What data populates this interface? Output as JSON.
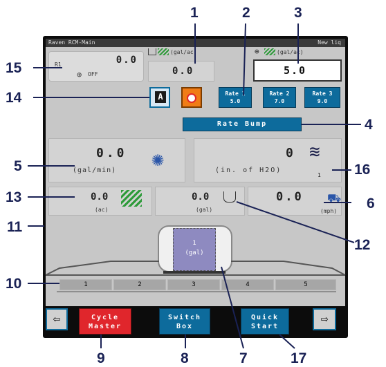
{
  "callouts": [
    "1",
    "2",
    "3",
    "4",
    "5",
    "6",
    "7",
    "8",
    "9",
    "10",
    "11",
    "12",
    "13",
    "14",
    "15",
    "16",
    "17"
  ],
  "titlebar": {
    "left": "Raven RCM-Main",
    "right": "New liq"
  },
  "master": {
    "row": "R1",
    "value": "0.0",
    "state": "OFF"
  },
  "actual": {
    "units": "(gal/ac)",
    "value": "0.0"
  },
  "target": {
    "units": "(gal/ac)",
    "value": "5.0"
  },
  "rates": [
    {
      "label": "Rate 1",
      "value": "5.0"
    },
    {
      "label": "Rate 2",
      "value": "7.0"
    },
    {
      "label": "Rate 3",
      "value": "9.0"
    }
  ],
  "rate_bump": "Rate Bump",
  "flow": {
    "value": "0.0",
    "units": "(gal/min)"
  },
  "pressure": {
    "value": "0",
    "units": "(in. of H2O)",
    "sensor": "1"
  },
  "area": {
    "value": "0.0",
    "units": "(ac)"
  },
  "volume": {
    "value": "0.0",
    "units": "(gal)"
  },
  "speed": {
    "value": "0.0",
    "units": "(mph)"
  },
  "tank": {
    "id": "1",
    "units": "(gal)"
  },
  "sections": [
    "1",
    "2",
    "3",
    "4",
    "5"
  ],
  "bottom": {
    "cycle": "Cycle Master",
    "switchbox": "Switch Box",
    "quickstart": "Quick Start"
  },
  "colors": {
    "accent": "#0d6b9c",
    "callout": "#1a2255",
    "cycle": "#e0262c"
  }
}
